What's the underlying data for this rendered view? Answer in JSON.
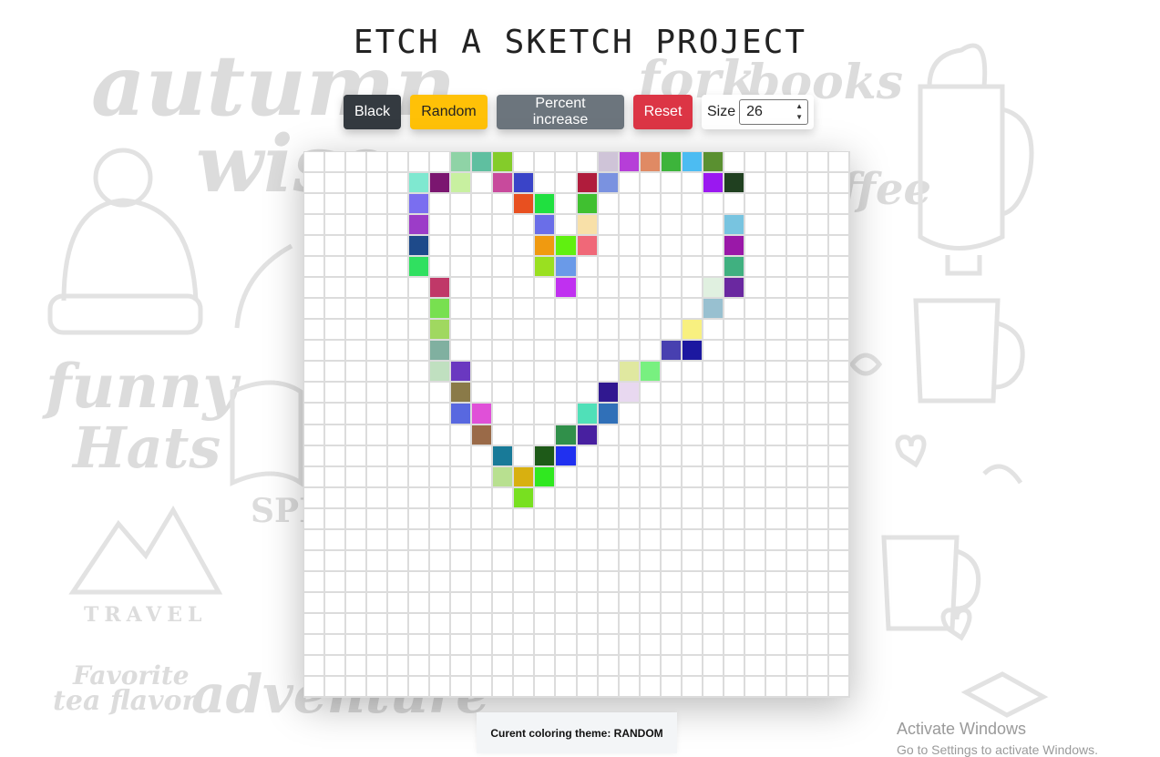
{
  "title": "ETCH A SKETCH PROJECT",
  "toolbar": {
    "black_label": "Black",
    "random_label": "Random",
    "percent_label": "Percent increase",
    "reset_label": "Reset",
    "size_label": "Size",
    "size_value": "26"
  },
  "status_text": "Curent coloring theme: RANDOM",
  "watermark": {
    "title": "Activate Windows",
    "subtitle": "Go to Settings to activate Windows."
  },
  "background_words": [
    "autumn",
    "wise",
    "funny",
    "Hats",
    "TRAVEL",
    "Favorite",
    "tea flavor",
    "adventure",
    "SPI",
    "fork",
    "books",
    "coffee"
  ],
  "colors": {
    "black": "#343a40",
    "random": "#ffc107",
    "percent": "#6c757d",
    "reset": "#dc3545"
  },
  "grid": {
    "size": 26,
    "filled_cells": [
      {
        "r": 0,
        "c": 7,
        "color": "#8fd3a6"
      },
      {
        "r": 0,
        "c": 8,
        "color": "#5fbfa0"
      },
      {
        "r": 0,
        "c": 9,
        "color": "#84cc2a"
      },
      {
        "r": 0,
        "c": 14,
        "color": "#cfc4d8"
      },
      {
        "r": 0,
        "c": 15,
        "color": "#b63ed8"
      },
      {
        "r": 0,
        "c": 16,
        "color": "#e08a64"
      },
      {
        "r": 0,
        "c": 17,
        "color": "#3db43b"
      },
      {
        "r": 0,
        "c": 18,
        "color": "#4cbcf2"
      },
      {
        "r": 0,
        "c": 19,
        "color": "#5a9030"
      },
      {
        "r": 1,
        "c": 5,
        "color": "#7fe8d0"
      },
      {
        "r": 1,
        "c": 6,
        "color": "#7b1670"
      },
      {
        "r": 1,
        "c": 7,
        "color": "#c8f0a0"
      },
      {
        "r": 1,
        "c": 9,
        "color": "#c84a9c"
      },
      {
        "r": 1,
        "c": 10,
        "color": "#3a44c8"
      },
      {
        "r": 1,
        "c": 13,
        "color": "#b01c3c"
      },
      {
        "r": 1,
        "c": 14,
        "color": "#7a92e0"
      },
      {
        "r": 1,
        "c": 19,
        "color": "#9a18f0"
      },
      {
        "r": 1,
        "c": 20,
        "color": "#204020"
      },
      {
        "r": 2,
        "c": 5,
        "color": "#7a6ef0"
      },
      {
        "r": 2,
        "c": 10,
        "color": "#e85020"
      },
      {
        "r": 2,
        "c": 11,
        "color": "#20e040"
      },
      {
        "r": 2,
        "c": 13,
        "color": "#40c030"
      },
      {
        "r": 3,
        "c": 5,
        "color": "#9c3cc8"
      },
      {
        "r": 3,
        "c": 11,
        "color": "#6a6ee8"
      },
      {
        "r": 3,
        "c": 13,
        "color": "#f8e0a8"
      },
      {
        "r": 3,
        "c": 20,
        "color": "#78c4e0"
      },
      {
        "r": 4,
        "c": 5,
        "color": "#1e4a8a"
      },
      {
        "r": 4,
        "c": 11,
        "color": "#f09a10"
      },
      {
        "r": 4,
        "c": 12,
        "color": "#60f010"
      },
      {
        "r": 4,
        "c": 13,
        "color": "#f06878"
      },
      {
        "r": 4,
        "c": 20,
        "color": "#9a18a8"
      },
      {
        "r": 5,
        "c": 5,
        "color": "#30e060"
      },
      {
        "r": 5,
        "c": 11,
        "color": "#9ae020"
      },
      {
        "r": 5,
        "c": 12,
        "color": "#6a9ae8"
      },
      {
        "r": 5,
        "c": 20,
        "color": "#40b080"
      },
      {
        "r": 6,
        "c": 6,
        "color": "#c03868"
      },
      {
        "r": 6,
        "c": 12,
        "color": "#c030f0"
      },
      {
        "r": 6,
        "c": 19,
        "color": "#e0f0e0"
      },
      {
        "r": 6,
        "c": 20,
        "color": "#6a28a0"
      },
      {
        "r": 7,
        "c": 6,
        "color": "#78e050"
      },
      {
        "r": 7,
        "c": 19,
        "color": "#98c0d0"
      },
      {
        "r": 8,
        "c": 6,
        "color": "#a0d860"
      },
      {
        "r": 8,
        "c": 18,
        "color": "#f8f080"
      },
      {
        "r": 9,
        "c": 6,
        "color": "#80b0a0"
      },
      {
        "r": 9,
        "c": 17,
        "color": "#4840b0"
      },
      {
        "r": 9,
        "c": 18,
        "color": "#1c18a0"
      },
      {
        "r": 10,
        "c": 6,
        "color": "#c0e0c0"
      },
      {
        "r": 10,
        "c": 7,
        "color": "#6a38c0"
      },
      {
        "r": 10,
        "c": 15,
        "color": "#e0e8a0"
      },
      {
        "r": 10,
        "c": 16,
        "color": "#78f080"
      },
      {
        "r": 11,
        "c": 7,
        "color": "#8a7a48"
      },
      {
        "r": 11,
        "c": 14,
        "color": "#301890"
      },
      {
        "r": 11,
        "c": 15,
        "color": "#e8d8f0"
      },
      {
        "r": 12,
        "c": 7,
        "color": "#5868e0"
      },
      {
        "r": 12,
        "c": 8,
        "color": "#e050d8"
      },
      {
        "r": 12,
        "c": 13,
        "color": "#50e0b8"
      },
      {
        "r": 12,
        "c": 14,
        "color": "#3070b8"
      },
      {
        "r": 13,
        "c": 8,
        "color": "#9a6a48"
      },
      {
        "r": 13,
        "c": 12,
        "color": "#30904a"
      },
      {
        "r": 13,
        "c": 13,
        "color": "#4820a0"
      },
      {
        "r": 14,
        "c": 9,
        "color": "#187a98"
      },
      {
        "r": 14,
        "c": 11,
        "color": "#1e5a18"
      },
      {
        "r": 14,
        "c": 12,
        "color": "#2030f0"
      },
      {
        "r": 15,
        "c": 9,
        "color": "#b8e090"
      },
      {
        "r": 15,
        "c": 10,
        "color": "#d8b010"
      },
      {
        "r": 15,
        "c": 11,
        "color": "#30e820"
      },
      {
        "r": 16,
        "c": 10,
        "color": "#78e020"
      }
    ]
  }
}
